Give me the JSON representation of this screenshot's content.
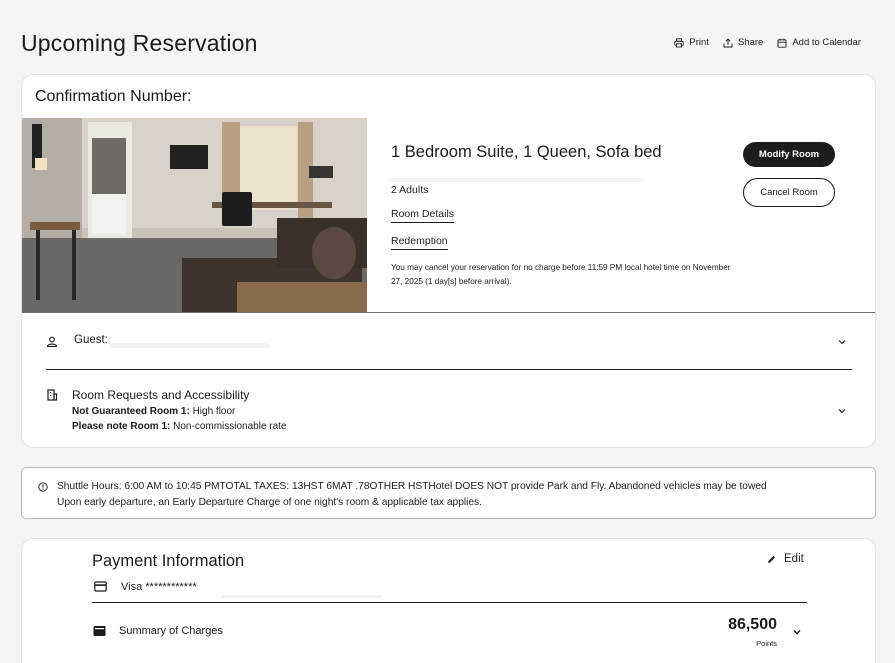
{
  "header": {
    "title": "Upcoming Reservation",
    "actions": [
      {
        "label": "Print",
        "icon": "print-icon"
      },
      {
        "label": "Share",
        "icon": "share-icon"
      },
      {
        "label": "Add to Calendar",
        "icon": "calendar-icon"
      }
    ]
  },
  "reservation": {
    "confirmation_label": "Confirmation Number:",
    "room_title": "1 Bedroom Suite, 1 Queen, Sofa bed",
    "adults": "2 Adults",
    "room_details_link": "Room Details",
    "redemption_link": "Redemption",
    "cancel_policy": "You may cancel your reservation for no charge before 11:59 PM local hotel time on November 27, 2025 (1 day[s] before arrival).",
    "modify_button": "Modify Room",
    "cancel_button": "Cancel Room"
  },
  "guest": {
    "label": "Guest:"
  },
  "requests": {
    "title": "Room Requests and Accessibility",
    "lines": [
      {
        "bold": "Not Guaranteed Room 1:",
        "text": " High floor"
      },
      {
        "bold": "Please note Room 1:",
        "text": " Non-commissionable rate"
      }
    ]
  },
  "notice": {
    "line1": "Shuttle Hours: 6:00 AM to 10:45 PMTOTAL TAXES: 13HST 6MAT .78OTHER HSTHotel DOES NOT provide Park and Fly. Abandoned vehicles may be towed",
    "line2": "Upon early departure, an Early Departure Charge of one night's room & applicable tax applies."
  },
  "payment": {
    "title": "Payment Information",
    "edit_label": "Edit",
    "card_text": "Visa ************",
    "summary_label": "Summary of Charges",
    "points_value": "86,500",
    "points_unit": "Points"
  },
  "colors": {
    "primary_dark": "#1c1c1c",
    "page_bg": "#f5f5f5",
    "card_bg": "#ffffff"
  }
}
